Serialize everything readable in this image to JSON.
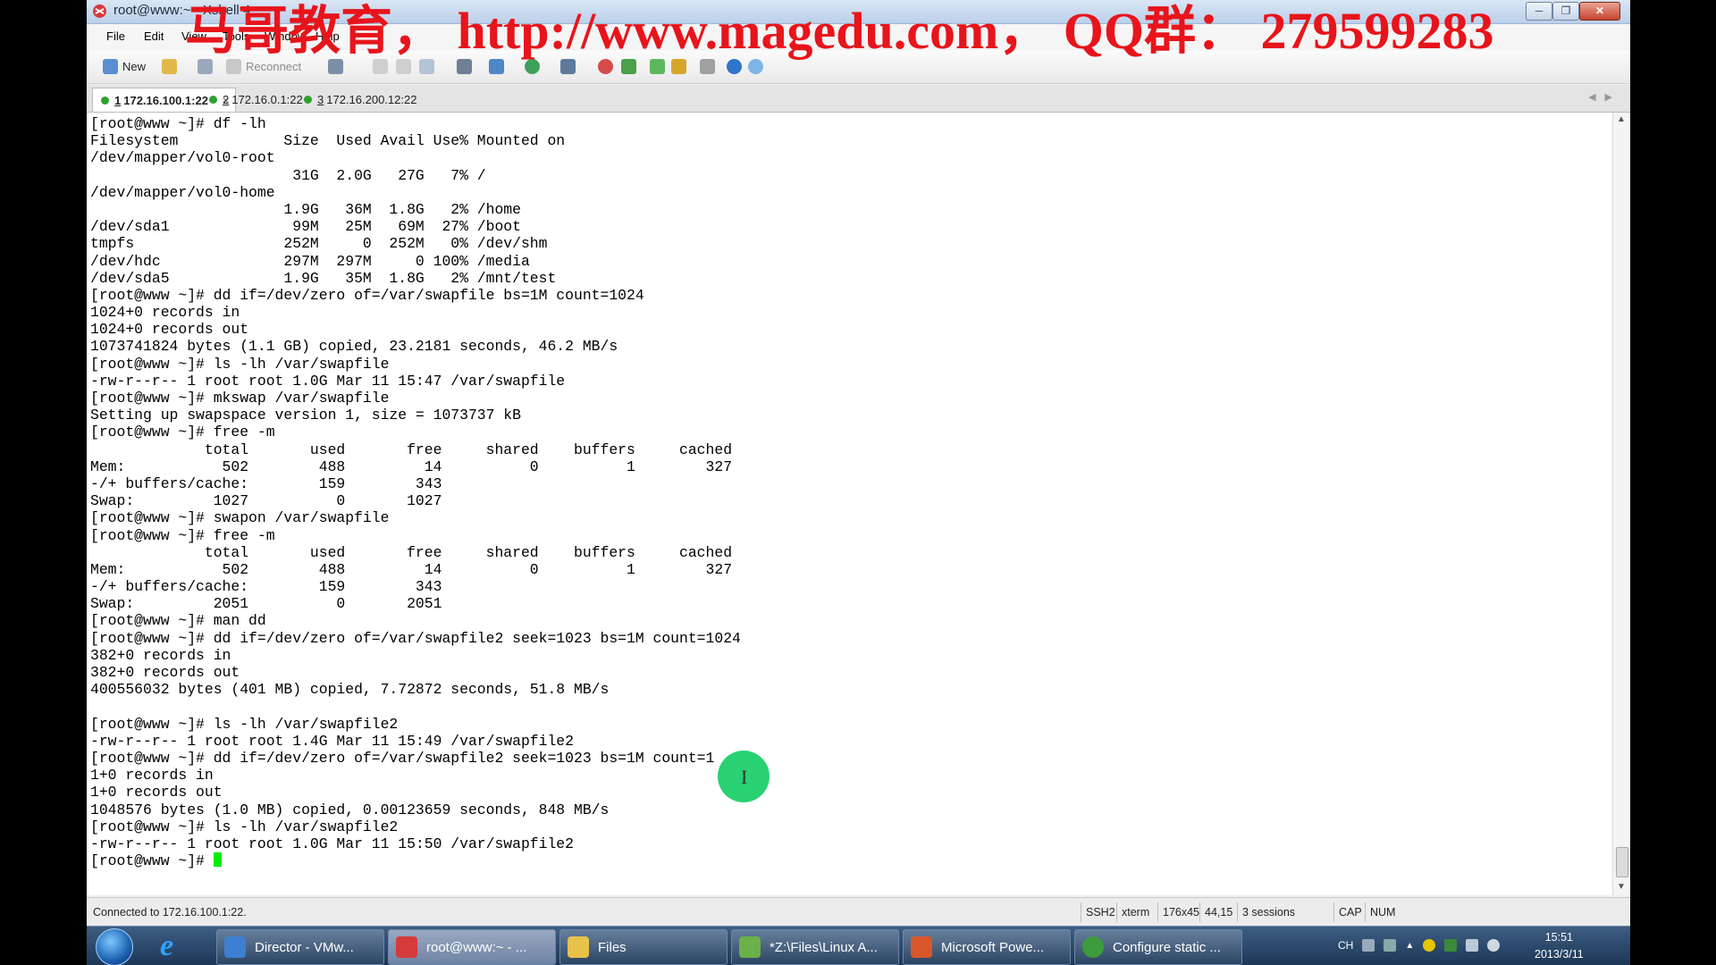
{
  "watermark": "马哥教育， http://www.magedu.com， QQ群： 279599283",
  "window": {
    "title": "root@www:~ - Xshell 4"
  },
  "menu": [
    "File",
    "Edit",
    "View",
    "Tools",
    "Window",
    "Help"
  ],
  "toolbar": {
    "new_label": "New",
    "reconnect_label": "Reconnect"
  },
  "tabs": [
    {
      "number": "1",
      "label": "172.16.100.1:22"
    },
    {
      "number": "2",
      "label": "172.16.0.1:22"
    },
    {
      "number": "3",
      "label": "172.16.200.12:22"
    }
  ],
  "terminal": {
    "lines": [
      "[root@www ~]# df -lh",
      "Filesystem            Size  Used Avail Use% Mounted on",
      "/dev/mapper/vol0-root",
      "                       31G  2.0G   27G   7% /",
      "/dev/mapper/vol0-home",
      "                      1.9G   36M  1.8G   2% /home",
      "/dev/sda1              99M   25M   69M  27% /boot",
      "tmpfs                 252M     0  252M   0% /dev/shm",
      "/dev/hdc              297M  297M     0 100% /media",
      "/dev/sda5             1.9G   35M  1.8G   2% /mnt/test",
      "[root@www ~]# dd if=/dev/zero of=/var/swapfile bs=1M count=1024",
      "1024+0 records in",
      "1024+0 records out",
      "1073741824 bytes (1.1 GB) copied, 23.2181 seconds, 46.2 MB/s",
      "[root@www ~]# ls -lh /var/swapfile",
      "-rw-r--r-- 1 root root 1.0G Mar 11 15:47 /var/swapfile",
      "[root@www ~]# mkswap /var/swapfile",
      "Setting up swapspace version 1, size = 1073737 kB",
      "[root@www ~]# free -m",
      "             total       used       free     shared    buffers     cached",
      "Mem:           502        488         14          0          1        327",
      "-/+ buffers/cache:        159        343",
      "Swap:         1027          0       1027",
      "[root@www ~]# swapon /var/swapfile",
      "[root@www ~]# free -m",
      "             total       used       free     shared    buffers     cached",
      "Mem:           502        488         14          0          1        327",
      "-/+ buffers/cache:        159        343",
      "Swap:         2051          0       2051",
      "[root@www ~]# man dd",
      "[root@www ~]# dd if=/dev/zero of=/var/swapfile2 seek=1023 bs=1M count=1024",
      "382+0 records in",
      "382+0 records out",
      "400556032 bytes (401 MB) copied, 7.72872 seconds, 51.8 MB/s",
      "",
      "[root@www ~]# ls -lh /var/swapfile2",
      "-rw-r--r-- 1 root root 1.4G Mar 11 15:49 /var/swapfile2",
      "[root@www ~]# dd if=/dev/zero of=/var/swapfile2 seek=1023 bs=1M count=1",
      "1+0 records in",
      "1+0 records out",
      "1048576 bytes (1.0 MB) copied, 0.00123659 seconds, 848 MB/s",
      "[root@www ~]# ls -lh /var/swapfile2",
      "-rw-r--r-- 1 root root 1.0G Mar 11 15:50 /var/swapfile2"
    ],
    "prompt": "[root@www ~]# "
  },
  "status": {
    "connection": "Connected to 172.16.100.1:22.",
    "protocol": "SSH2",
    "term_type": "xterm",
    "size": "176x45",
    "cursor_pos": "44,15",
    "sessions": "3 sessions",
    "caps": "CAP",
    "num": "NUM"
  },
  "taskbar": {
    "items": [
      {
        "label": "Director - VMw...",
        "color": "#3d7fd1"
      },
      {
        "label": "root@www:~ - ...",
        "color": "#d63b3b"
      },
      {
        "label": "Files",
        "color": "#e7c14a"
      },
      {
        "label": "*Z:\\Files\\Linux A...",
        "color": "#6bb04a"
      },
      {
        "label": "Microsoft Powe...",
        "color": "#d8572a"
      },
      {
        "label": "Configure static ...",
        "color": "#3c9c3c"
      }
    ],
    "tray_lang": "CH",
    "clock_time": "15:51",
    "clock_date": "2013/3/11"
  },
  "colors": {
    "watermark": "#e8141b",
    "cursor": "#00ee00",
    "mouse_highlight": "#29d172",
    "tab_dot": "#2ea02e"
  }
}
